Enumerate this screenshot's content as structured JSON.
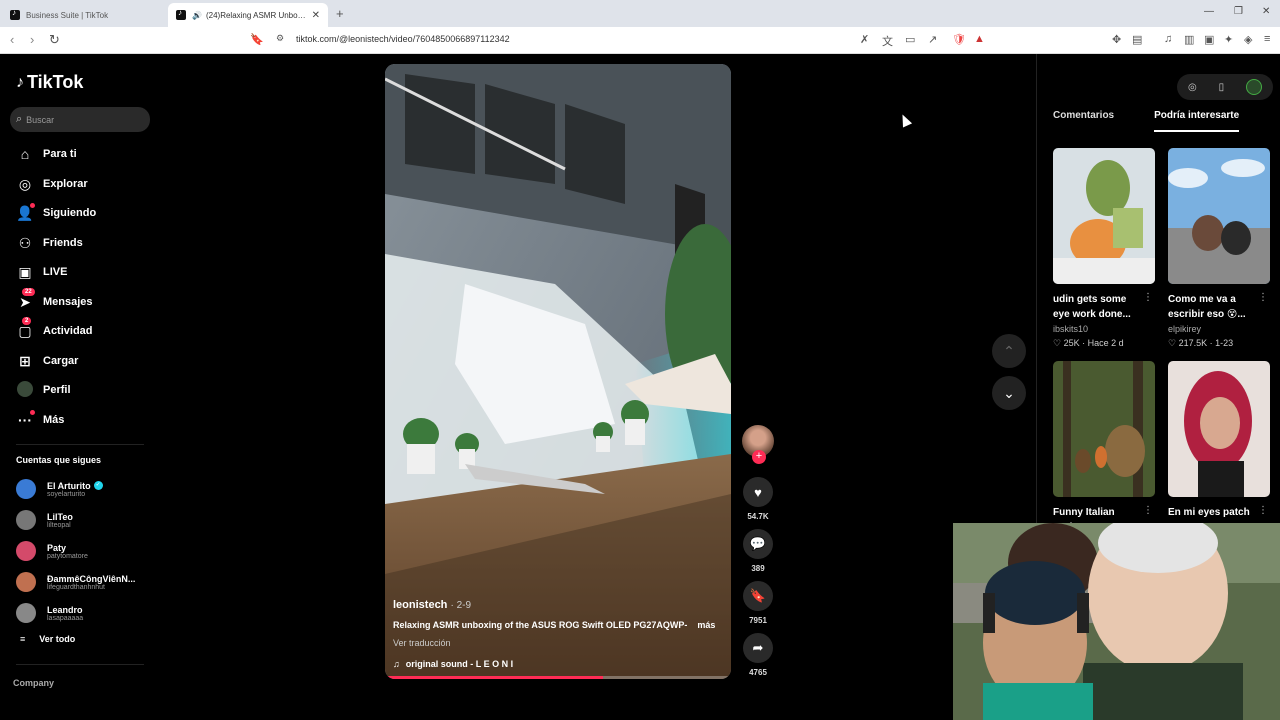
{
  "browser": {
    "tabs": [
      {
        "label": "Business Suite | TikTok",
        "active": false
      },
      {
        "label": "(24)Relaxing ASMR Unboxing",
        "active": true
      }
    ],
    "url": "tiktok.com/@leonistech/video/7604850066897112342"
  },
  "sidebar": {
    "brand": "TikTok",
    "search_placeholder": "Buscar",
    "nav": [
      {
        "label": "Para ti",
        "icon": "home-icon"
      },
      {
        "label": "Explorar",
        "icon": "compass-icon"
      },
      {
        "label": "Siguiendo",
        "icon": "user-follow-icon"
      },
      {
        "label": "Friends",
        "icon": "friends-icon"
      },
      {
        "label": "LIVE",
        "icon": "live-tv-icon"
      },
      {
        "label": "Mensajes",
        "icon": "paper-plane-icon",
        "badge": "22"
      },
      {
        "label": "Actividad",
        "icon": "activity-icon",
        "badge": "2"
      },
      {
        "label": "Cargar",
        "icon": "plus-box-icon"
      },
      {
        "label": "Perfil",
        "icon": "profile-avatar-icon"
      },
      {
        "label": "Más",
        "icon": "more-dots-icon"
      }
    ],
    "following_title": "Cuentas que sigues",
    "following": [
      {
        "name": "El Arturito",
        "handle": "soyelarturito",
        "verified": true,
        "color": "#3a7bd5"
      },
      {
        "name": "LilTeo",
        "handle": "lilteopal",
        "verified": false,
        "color": "#666"
      },
      {
        "name": "Paty",
        "handle": "patytomatore",
        "verified": false,
        "color": "#d44a6a"
      },
      {
        "name": "ĐammêCôngViênN...",
        "handle": "lifeguardthanhnhut",
        "verified": false,
        "color": "#c07050"
      },
      {
        "name": "Leandro",
        "handle": "lasapaaaaa",
        "verified": false,
        "color": "#888"
      }
    ],
    "see_all": "Ver todo",
    "company": "Company"
  },
  "video": {
    "author": "leonistech",
    "date": "· 2-9",
    "caption": "Relaxing ASMR unboxing of the ASUS ROG Swift OLED PG27AQWP-",
    "more": "más",
    "translate": "Ver traducción",
    "sound": "original sound - L E O N I",
    "progress": 0.63
  },
  "actions": {
    "likes": "54.7K",
    "comments": "389",
    "saves": "7951",
    "shares": "4765"
  },
  "right_panel": {
    "tabs": [
      "Comentarios",
      "Podría interesarte"
    ],
    "active_tab": 1,
    "cards": [
      {
        "title": "udin gets some eye work done...",
        "user": "ibskits10",
        "likes": "25K",
        "date": "Hace 2 d"
      },
      {
        "title": "Como me va a escribir eso 😵...",
        "user": "elpikirey",
        "likes": "217.5K",
        "date": "1-23"
      },
      {
        "title": "Funny Italian Brainrot",
        "user": "",
        "likes": "",
        "date": ""
      },
      {
        "title": "En mi eyes patch era...",
        "user": "",
        "likes": "",
        "date": ""
      }
    ]
  },
  "colors": {
    "accent": "#fe2c55",
    "verified": "#20d5ec"
  }
}
